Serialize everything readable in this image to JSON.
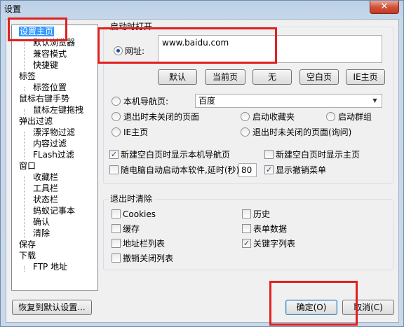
{
  "window": {
    "title": "设置",
    "close_glyph": "✕"
  },
  "tree": {
    "items": [
      {
        "label": "设置主页",
        "selected": true
      },
      {
        "label": "默认浏览器"
      },
      {
        "label": "兼容模式"
      },
      {
        "label": "快捷键"
      },
      {
        "label": "标签"
      },
      {
        "label": "标签位置"
      },
      {
        "label": "鼠标右键手势"
      },
      {
        "label": "鼠标左键拖拽"
      },
      {
        "label": "弹出过滤"
      },
      {
        "label": "漂浮物过滤"
      },
      {
        "label": "内容过滤"
      },
      {
        "label": "FLash过滤"
      },
      {
        "label": "窗口"
      },
      {
        "label": "收藏栏"
      },
      {
        "label": "工具栏"
      },
      {
        "label": "状态栏"
      },
      {
        "label": "蚂蚁记事本"
      },
      {
        "label": "确认"
      },
      {
        "label": "清除"
      },
      {
        "label": "保存"
      },
      {
        "label": "下载"
      },
      {
        "label": "FTP 地址"
      }
    ]
  },
  "startup": {
    "group_label": "启动时打开",
    "url_label": "网址:",
    "url_value": "www.baidu.com",
    "buttons": [
      "默认",
      "当前页",
      "无",
      "空白页",
      "IE主页"
    ],
    "local_nav_label": "本机导航页:",
    "local_nav_value": "百度",
    "radio_unclosed": "退出时未关闭的页面",
    "radio_favorites": "启动收藏夹",
    "radio_group": "启动群组",
    "radio_ie_home": "IE主页",
    "radio_unclosed_ask": "退出时未关闭的页面(询问)"
  },
  "options": {
    "new_blank_local_nav": "新建空白页时显示本机导航页",
    "new_blank_home": "新建空白页时显示主页",
    "autostart": "随电脑自动启动本软件,延时(秒)",
    "autostart_delay": "80",
    "show_undo_menu": "显示撤销菜单"
  },
  "clear_on_exit": {
    "group_label": "退出时清除",
    "cookies": "Cookies",
    "history": "历史",
    "cache": "缓存",
    "form_data": "表单数据",
    "address_list": "地址栏列表",
    "keyword_list": "关键字列表",
    "undo_close_list": "撤销关闭列表"
  },
  "footer": {
    "restore_defaults": "恢复到默认设置...",
    "ok": "确定(O)",
    "cancel": "取消(C)"
  },
  "check_glyph": "✓"
}
